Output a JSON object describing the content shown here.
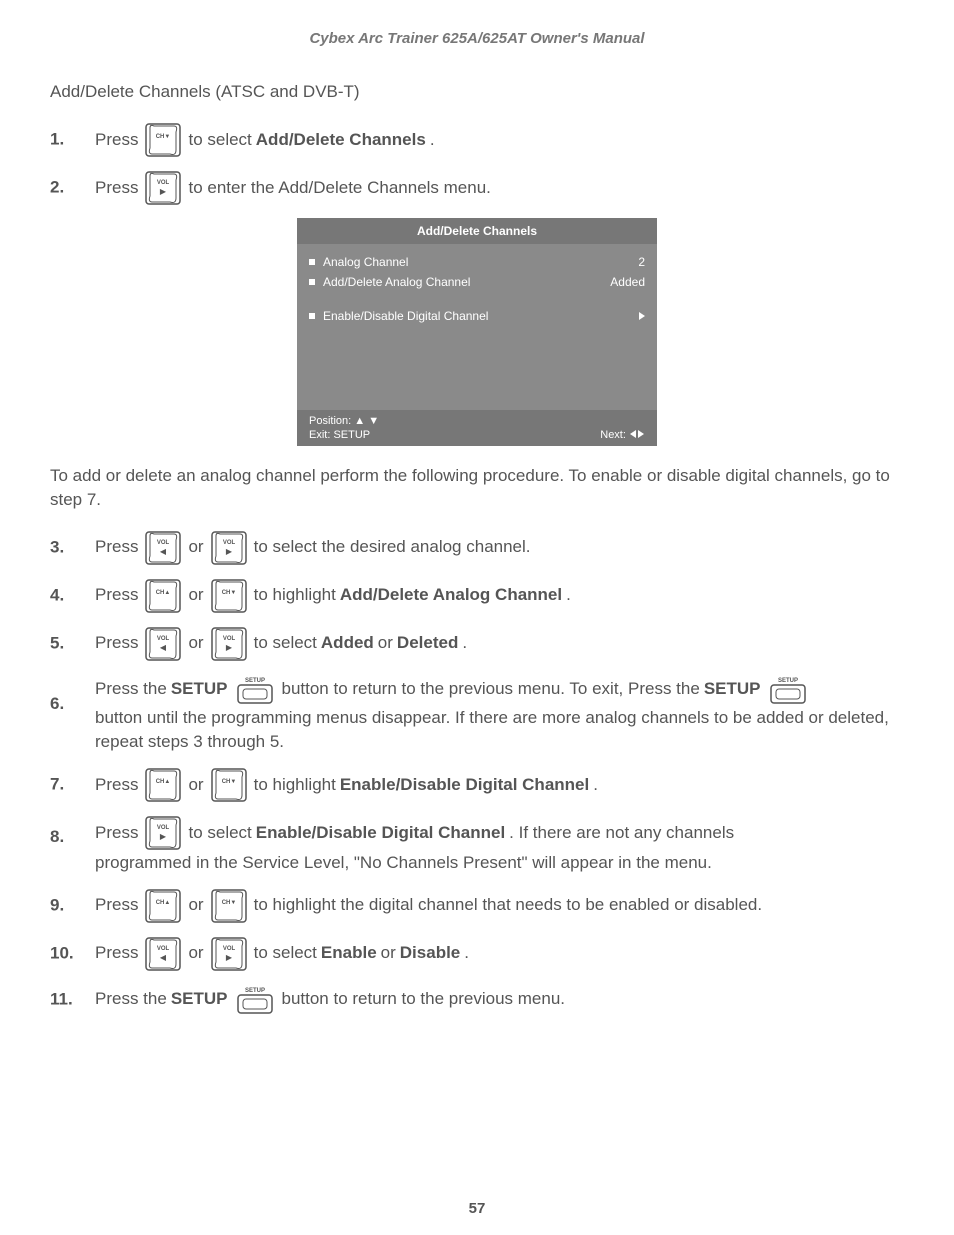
{
  "header": {
    "title": "Cybex Arc Trainer 625A/625AT Owner's Manual"
  },
  "section": {
    "title": "Add/Delete Channels (ATSC and DVB-T)"
  },
  "steps": {
    "s1": {
      "num": "1.",
      "a": "Press ",
      "b": " to select ",
      "c": "Add/Delete Channels",
      "d": "."
    },
    "s2": {
      "num": "2.",
      "a": "Press ",
      "b": " to enter the Add/Delete Channels menu."
    },
    "s3": {
      "num": "3.",
      "a": "Press ",
      "or": " or ",
      "b": " to select the desired analog channel."
    },
    "s4": {
      "num": "4.",
      "a": "Press ",
      "or": " or ",
      "b": " to highlight ",
      "c": "Add/Delete Analog Channel",
      "d": "."
    },
    "s5": {
      "num": "5.",
      "a": "Press ",
      "or": " or ",
      "b": " to select ",
      "c": "Added",
      "d": " or ",
      "e": "Deleted",
      "f": "."
    },
    "s6": {
      "num": "6.",
      "a": "Press the ",
      "b": "SETUP",
      "c": " button to return to the previous menu. To exit, Press the ",
      "d": "SETUP",
      "rest": "button until the programming menus disappear. If there are more analog channels to be added or deleted, repeat steps 3 through 5."
    },
    "s7": {
      "num": "7.",
      "a": "Press ",
      "or": " or ",
      "b": " to highlight ",
      "c": "Enable/Disable Digital Channel",
      "d": "."
    },
    "s8": {
      "num": "8.",
      "a": "Press ",
      "b": " to select ",
      "c": "Enable/Disable Digital Channel",
      "d": ". If there are not any channels ",
      "rest": "programmed in the Service Level, \"No Channels Present\" will appear in the menu."
    },
    "s9": {
      "num": "9.",
      "a": "Press ",
      "or": " or ",
      "b": " to highlight the digital channel that needs to be enabled or disabled."
    },
    "s10": {
      "num": "10.",
      "a": "Press ",
      "or": " or ",
      "b": " to select ",
      "c": "Enable",
      "d": " or ",
      "e": "Disable",
      "f": "."
    },
    "s11": {
      "num": "11.",
      "a": "Press the ",
      "b": "SETUP",
      "c": " button to return to the previous menu."
    }
  },
  "para1": "To add or delete an analog channel perform the following procedure. To enable or disable digital channels, go to step 7.",
  "osd": {
    "title": "Add/Delete Channels",
    "rows": [
      {
        "label": "Analog Channel",
        "value": "2"
      },
      {
        "label": "Add/Delete Analog Channel",
        "value": "Added"
      }
    ],
    "row3": {
      "label": "Enable/Disable Digital Channel"
    },
    "footer": {
      "position": "Position: ▲ ▼",
      "exit": "Exit: SETUP",
      "next": "Next:"
    }
  },
  "buttons": {
    "chdown": "CH▼",
    "chup": "CH▲",
    "volright": "VOL",
    "volleft": "VOL",
    "setup": "SETUP"
  },
  "pageNumber": "57"
}
